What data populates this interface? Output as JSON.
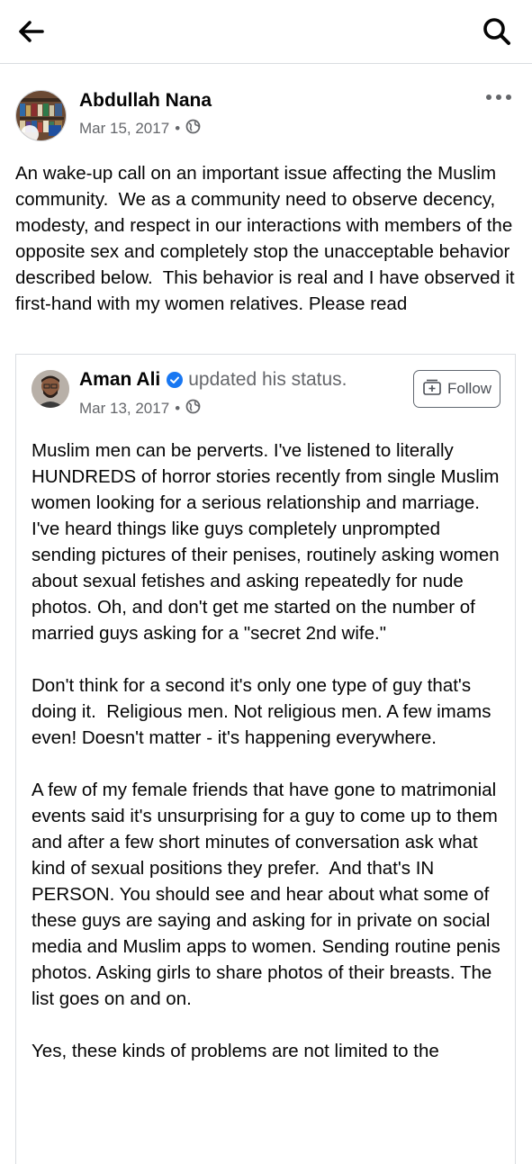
{
  "post": {
    "author": "Abdullah Nana",
    "date": "Mar 15, 2017",
    "separator": "•",
    "audience_icon": "globe-icon",
    "text": "An wake-up call on an important issue affecting the Muslim community.  We as a community need to observe decency, modesty, and respect in our interactions with members of the opposite sex and completely stop the unacceptable behavior described below.  This behavior is real and I have observed it first-hand with my women relatives. Please read"
  },
  "shared": {
    "author": "Aman Ali",
    "action": "updated his status.",
    "date": "Mar 13, 2017",
    "separator": "•",
    "follow_label": "Follow",
    "paragraphs": [
      "Muslim men can be perverts. I've listened to literally HUNDREDS of horror stories recently from single Muslim women looking for a serious relationship and marriage.  I've heard things like guys completely unprompted sending pictures of their penises, routinely asking women about sexual fetishes and asking repeatedly for nude photos. Oh, and don't get me started on the number of married guys asking for a \"secret 2nd wife.\"",
      "Don't think for a second it's only one type of guy that's doing it.  Religious men. Not religious men. A few imams even! Doesn't matter - it's happening everywhere.",
      "A few of my female friends that have gone to matrimonial events said it's unsurprising for a guy to come up to them and after a few short minutes of conversation ask what kind of sexual positions they prefer.  And that's IN PERSON. You should see and hear about what some of these guys are saying and asking for in private on social media and Muslim apps to women. Sending routine penis photos. Asking girls to share photos of their breasts. The list goes on and on.",
      "Yes, these kinds of problems are not limited to the"
    ]
  },
  "icons": {
    "back": "back-arrow-icon",
    "search": "search-icon",
    "more": "more-options-icon",
    "verified": "verified-badge-icon",
    "follow": "follow-icon"
  },
  "colors": {
    "verified": "#1877f2",
    "meta_text": "#65676b",
    "divider": "#dadde1"
  }
}
